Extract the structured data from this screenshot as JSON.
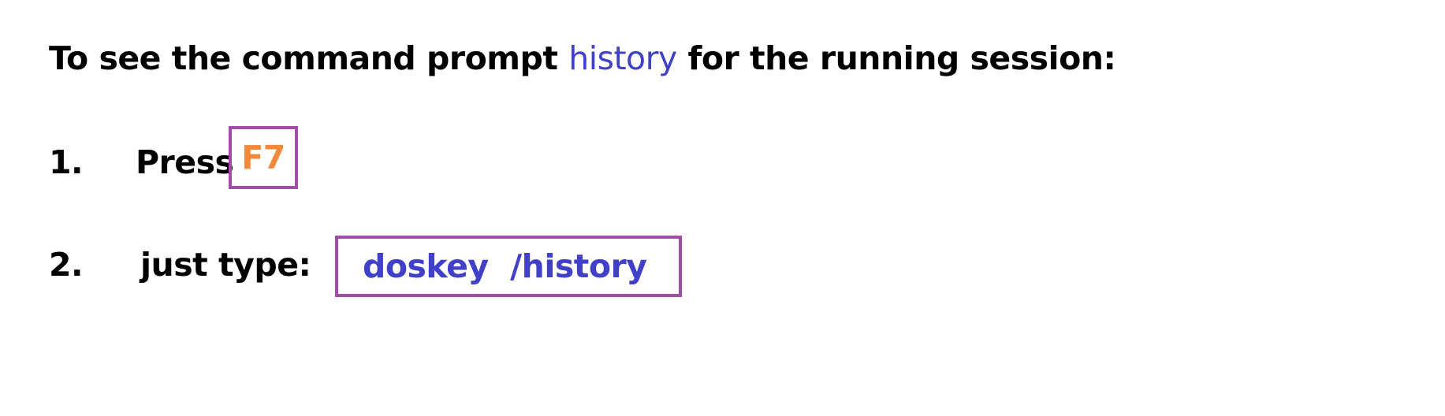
{
  "heading": {
    "before": "To see the command prompt ",
    "accent": "history",
    "after": " for the running session:"
  },
  "steps": [
    {
      "number": "1.",
      "label": "Press",
      "key": "F7"
    },
    {
      "number": "2.",
      "label": "just type:",
      "command": "doskey  /history"
    }
  ],
  "colors": {
    "text": "#000000",
    "accent_blue": "#4040c8",
    "key_orange": "#f2883a",
    "box_border": "#a24ca8"
  }
}
